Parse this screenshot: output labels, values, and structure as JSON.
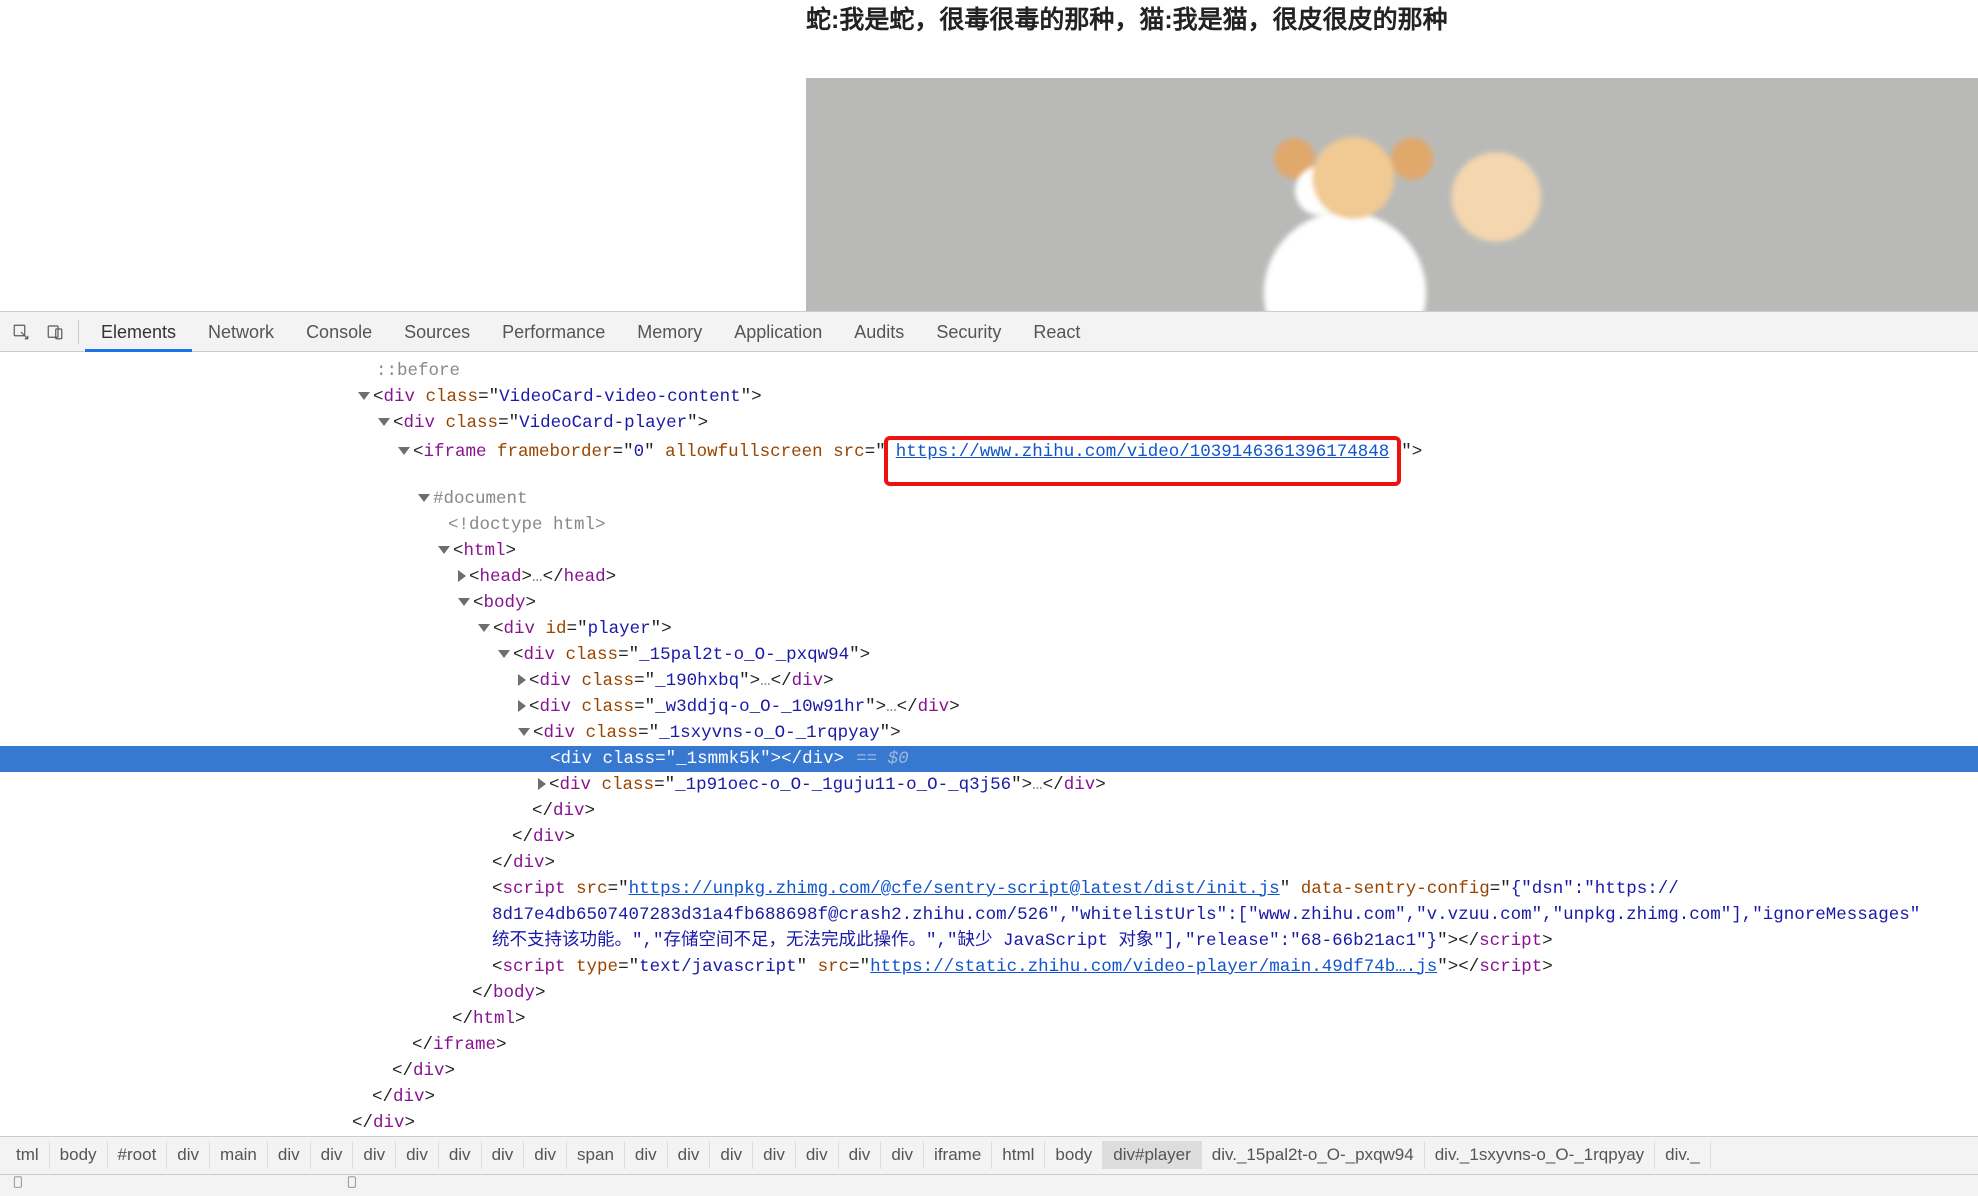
{
  "page": {
    "title_text": "蛇:我是蛇，很毒很毒的那种，猫:我是猫，很皮很皮的那种"
  },
  "devtools": {
    "tabs": [
      "Elements",
      "Network",
      "Console",
      "Sources",
      "Performance",
      "Memory",
      "Application",
      "Audits",
      "Security",
      "React"
    ],
    "active_tab": "Elements"
  },
  "dom": {
    "before": "::before",
    "div_vcc": {
      "attr_class": "class",
      "cls": "VideoCard-video-content"
    },
    "div_vcp": {
      "attr_class": "class",
      "cls": "VideoCard-player"
    },
    "iframe": {
      "tag_open": "iframe",
      "attr_fb": "frameborder",
      "fb_val": "0",
      "attr_afs": "allowfullscreen",
      "attr_src": "src",
      "src_val": "https://www.zhihu.com/video/1039146361396174848"
    },
    "docnode": "#document",
    "doctype": "<!doctype html>",
    "html_tag": "html",
    "head_tag": "head",
    "body_tag": "body",
    "div_player": {
      "attr_id": "id",
      "val": "player"
    },
    "div_c1": "_15pal2t-o_O-_pxqw94",
    "div_c2": "_190hxbq",
    "div_c3": "_w3ddjq-o_O-_10w91hr",
    "div_c4": "_1sxyvns-o_O-_1rqpyay",
    "div_sel": "_1smmk5k",
    "eqzero_text": "== $0",
    "div_c5": "_1p91oec-o_O-_1guju11-o_O-_q3j56",
    "close_div": "div",
    "script1": {
      "attr_src": "src",
      "src_val": "https://unpkg.zhimg.com/@cfe/sentry-script@latest/dist/init.js",
      "attr_cfg": "data-sentry-config",
      "cfg_part1": "{\"dsn\":\"https://",
      "cfg_part2": "8d17e4db6507407283d31a4fb688698f@crash2.zhihu.com/526\",\"whitelistUrls\":[\"www.zhihu.com\",\"v.vzuu.com\",\"unpkg.zhimg.com\"],\"ignoreMessages\"",
      "cfg_part3a": "统不支持该功能。\",\"存储空间不足，无法完成此操作。\",\"缺少 ",
      "cfg_part3_js": "JavaScript",
      "cfg_part3b": " 对象\"],\"release\":\"68-66b21ac1\"}",
      "close": "script"
    },
    "script2": {
      "attr_type": "type",
      "type_val": "text/javascript",
      "attr_src": "src",
      "src_val": "https://static.zhihu.com/video-player/main.49df74b….js",
      "close": "script"
    },
    "iframe_close": "iframe",
    "dots": "…"
  },
  "breadcrumbs": [
    "tml",
    "body",
    "#root",
    "div",
    "main",
    "div",
    "div",
    "div",
    "div",
    "div",
    "div",
    "div",
    "span",
    "div",
    "div",
    "div",
    "div",
    "div",
    "div",
    "div",
    "iframe",
    "html",
    "body",
    "div#player",
    "div._15pal2t-o_O-_pxqw94",
    "div._1sxyvns-o_O-_1rqpyay",
    "div._"
  ],
  "breadcrumbs_active_index": 23
}
